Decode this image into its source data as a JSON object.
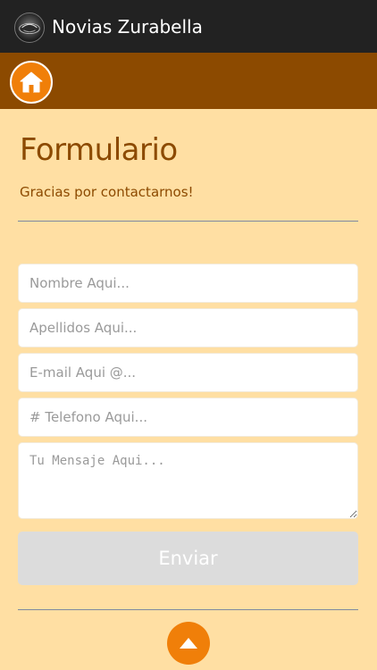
{
  "app": {
    "title": "Novias Zurabella"
  },
  "page": {
    "title": "Formulario",
    "subtitle": "Gracias por contactarnos!"
  },
  "form": {
    "nombre_placeholder": "Nombre Aqui...",
    "apellidos_placeholder": "Apellidos Aqui...",
    "email_placeholder": "E-mail Aqui @...",
    "telefono_placeholder": "# Telefono Aqui...",
    "mensaje_placeholder": "Tu Mensaje Aqui...",
    "submit_label": "Enviar"
  },
  "icons": {
    "app_logo": "brand-logo-icon",
    "home": "home-icon",
    "scroll_top": "triangle-up-icon"
  },
  "colors": {
    "background": "#FFDFA3",
    "appbar": "#222222",
    "navbar": "#8C4A00",
    "accent": "#F07F09",
    "title_text": "#8C4A00",
    "button_disabled": "#DCDCDC"
  }
}
